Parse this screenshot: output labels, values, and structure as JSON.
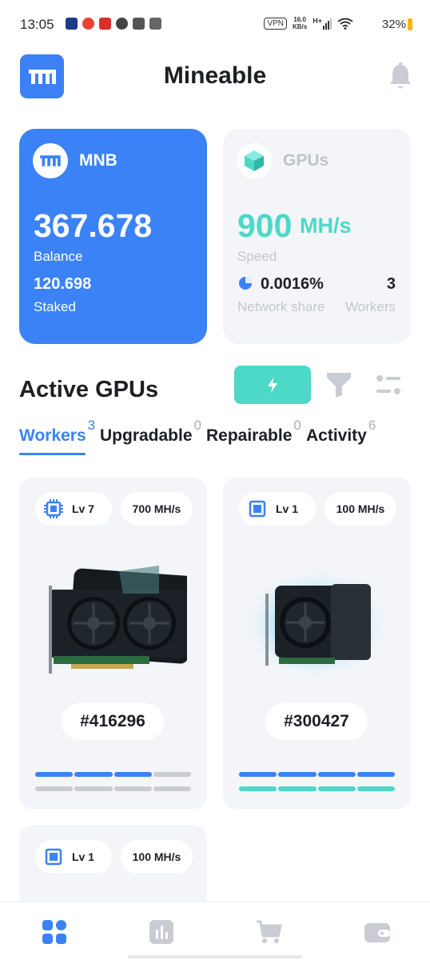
{
  "status_bar": {
    "time": "13:05",
    "vpn": "VPN",
    "net_speed_value": "16.0",
    "net_speed_unit": "KB/s",
    "network_type": "H+",
    "battery": "32%"
  },
  "header": {
    "title": "Mineable"
  },
  "mnb_card": {
    "name": "MNB",
    "balance": "367.678",
    "balance_label": "Balance",
    "staked": "120.698",
    "staked_label": "Staked"
  },
  "gpu_card": {
    "name": "GPUs",
    "speed_value": "900",
    "speed_unit": "MH/s",
    "speed_label": "Speed",
    "network_share": "0.0016%",
    "network_share_label": "Network share",
    "workers": "3",
    "workers_label": "Workers"
  },
  "active_gpus": {
    "title": "Active GPUs",
    "tabs": [
      {
        "label": "Workers",
        "count": "3"
      },
      {
        "label": "Upgradable",
        "count": "0"
      },
      {
        "label": "Repairable",
        "count": "0"
      },
      {
        "label": "Activity",
        "count": "6"
      }
    ]
  },
  "workers": [
    {
      "level": "Lv 7",
      "speed": "700 MH/s",
      "id": "#416296",
      "bar1_filled": 3,
      "bar2_filled": 0
    },
    {
      "level": "Lv 1",
      "speed": "100 MH/s",
      "id": "#300427",
      "bar1_filled": 4,
      "bar2_filled": 4
    },
    {
      "level": "Lv 1",
      "speed": "100 MH/s"
    }
  ],
  "colors": {
    "primary": "#3b82f6",
    "accent": "#4cd9c7",
    "card_bg": "#f3f5f8",
    "muted": "#bfc4cc"
  },
  "icons": {
    "nav": [
      "dashboard-icon",
      "stats-icon",
      "cart-icon",
      "wallet-icon"
    ]
  }
}
